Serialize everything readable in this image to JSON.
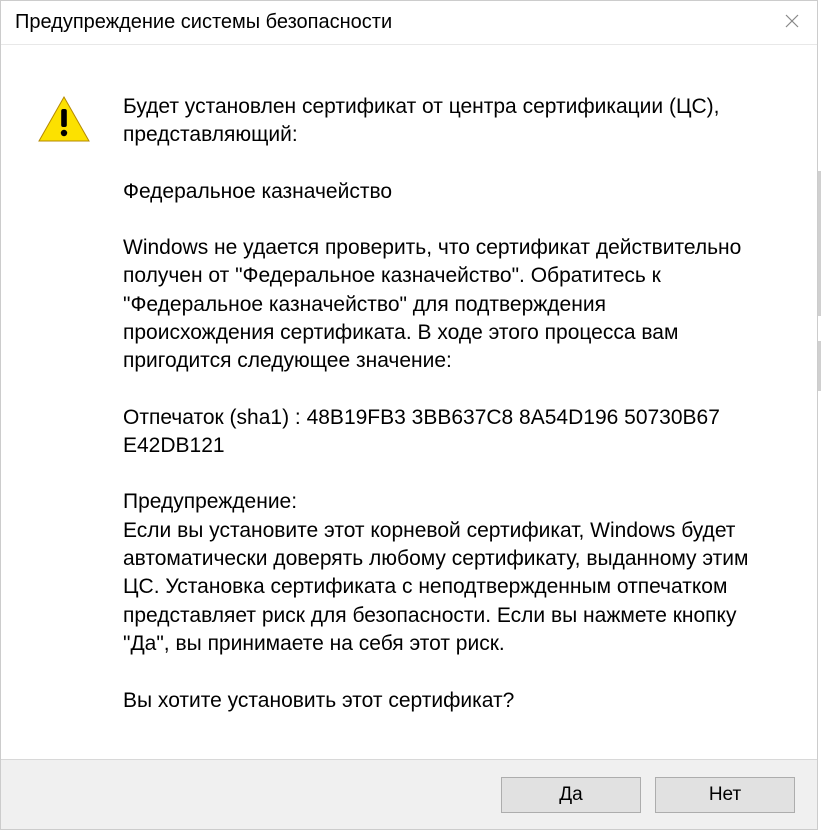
{
  "titlebar": {
    "title": "Предупреждение системы безопасности"
  },
  "body": {
    "intro": "Будет установлен сертификат от центра сертификации (ЦС), представляющий:",
    "issuer": "Федеральное казначейство",
    "cannot_verify": "Windows не удается проверить, что сертификат действительно получен от \"Федеральное казначейство\". Обратитесь к \"Федеральное казначейство\" для подтверждения происхождения сертификата. В ходе этого процесса вам пригодится следующее значение:",
    "thumbprint": "Отпечаток (sha1) : 48B19FB3 3BB637C8 8A54D196 50730B67 E42DB121",
    "warning_label": "Предупреждение:",
    "warning_text": "Если вы установите этот корневой сертификат, Windows будет автоматически доверять любому сертификату, выданному этим ЦС. Установка сертификата с неподтвержденным отпечатком представляет риск для безопасности. Если вы нажмете кнопку \"Да\", вы принимаете на себя этот риск.",
    "question": "Вы хотите установить этот сертификат?"
  },
  "buttons": {
    "yes": "Да",
    "no": "Нет"
  }
}
